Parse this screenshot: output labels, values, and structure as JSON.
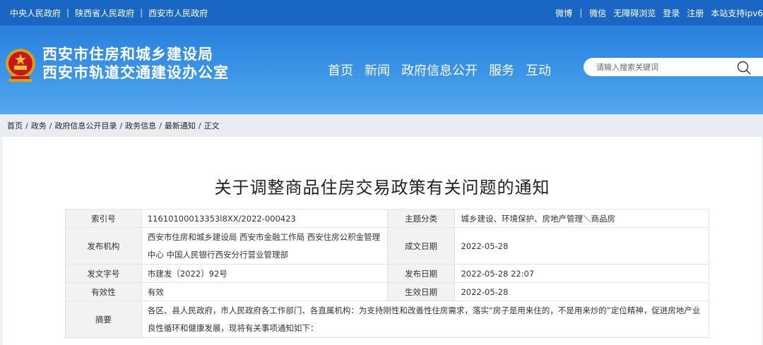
{
  "topbar": {
    "links": [
      "中央人民政府",
      "陕西省人民政府",
      "西安市人民政府"
    ],
    "right": [
      "微博",
      "微信",
      "无障碍浏览",
      "登录",
      "注册",
      "本站支持ipv6"
    ]
  },
  "header": {
    "title_line1": "西安市住房和城乡建设局",
    "title_line2": "西安市轨道交通建设办公室",
    "nav": [
      "首页",
      "新闻",
      "政府信息公开",
      "服务",
      "互动"
    ],
    "search_placeholder": "请输入搜索关键词"
  },
  "breadcrumb": [
    "首页",
    "政务",
    "政府信息公开目录",
    "政务信息",
    "最新通知",
    "正文"
  ],
  "article": {
    "title": "关于调整商品住房交易政策有关问题的通知"
  },
  "meta": {
    "index_label": "索引号",
    "index_value": "11610100013353l8XX/2022-000423",
    "topic_label": "主题分类",
    "topic_value": "城乡建设、环境保护、房地产管理＼商品房",
    "issuer_label": "发布机构",
    "issuer_value": "西安市住房和城乡建设局 西安市金融工作局 西安住房公积金管理中心 中国人民银行西安分行营业管理部",
    "created_label": "成文日期",
    "created_value": "2022-05-28",
    "docno_label": "发文字号",
    "docno_value": "市建发〔2022〕92号",
    "published_label": "发布日期",
    "published_value": "2022-05-28 22:07",
    "validity_label": "有效性",
    "validity_value": "有效",
    "effective_label": "生效日期",
    "effective_value": "2022-05-28",
    "summary_label": "摘要",
    "summary_value": "各区、县人民政府，市人民政府各工作部门、各直属机构：为支持刚性和改善性住房需求，落实“房子是用来住的，不是用来炒的”定位精神，促进房地产业良性循环和健康发展，现将有关事项通知如下："
  }
}
